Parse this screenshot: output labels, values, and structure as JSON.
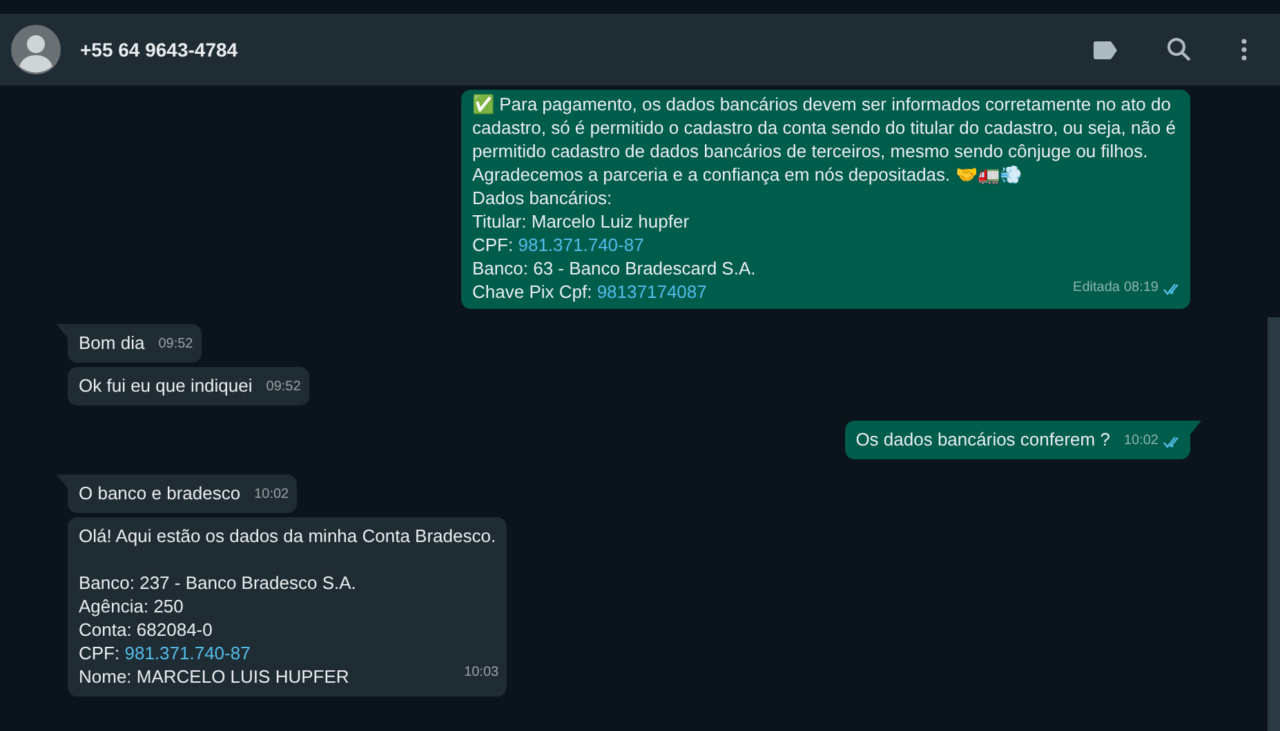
{
  "header": {
    "contact": "+55 64 9643-4784"
  },
  "messages": [
    {
      "kind": "out",
      "edited": "Editada",
      "time": "08:19",
      "read": true,
      "tail": false,
      "lines": [
        {
          "text": "✅ Para pagamento, os dados bancários devem ser informados corretamente no ato do cadastro, só é permitido o cadastro da conta sendo do titular do cadastro, ou seja, não é permitido cadastro de dados bancários de terceiros, mesmo sendo cônjuge ou filhos."
        },
        {
          "text": "Agradecemos a parceria e a confiança em nós depositadas. 🤝🚛💨"
        },
        {
          "text": "Dados bancários:"
        },
        {
          "text": "Titular: Marcelo Luiz hupfer"
        },
        {
          "text": "CPF: ",
          "link": "981.371.740-87"
        },
        {
          "text": "Banco: 63 - Banco Bradescard S.A."
        },
        {
          "text": "Chave Pix Cpf: ",
          "link": "98137174087"
        }
      ]
    },
    {
      "kind": "in",
      "time": "09:52",
      "tail": true,
      "lines": [
        {
          "text": "Bom dia"
        }
      ]
    },
    {
      "kind": "in",
      "time": "09:52",
      "tail": false,
      "lines": [
        {
          "text": "Ok fui eu que indiquei"
        }
      ]
    },
    {
      "kind": "out",
      "time": "10:02",
      "read": true,
      "tail": true,
      "lines": [
        {
          "text": "Os dados bancários conferem ?"
        }
      ]
    },
    {
      "kind": "in",
      "time": "10:02",
      "tail": true,
      "lines": [
        {
          "text": "O banco e bradesco"
        }
      ]
    },
    {
      "kind": "in",
      "time": "10:03",
      "tail": false,
      "lines": [
        {
          "text": "Olá! Aqui estão os dados da minha Conta Bradesco."
        },
        {
          "text": "Banco: 237 - Banco Bradesco S.A.",
          "blank_before": true
        },
        {
          "text": "Agência: 250"
        },
        {
          "text": "Conta: 682084-0"
        },
        {
          "text": "CPF: ",
          "link": "981.371.740-87"
        },
        {
          "text": "Nome: MARCELO LUIS HUPFER"
        }
      ]
    }
  ]
}
